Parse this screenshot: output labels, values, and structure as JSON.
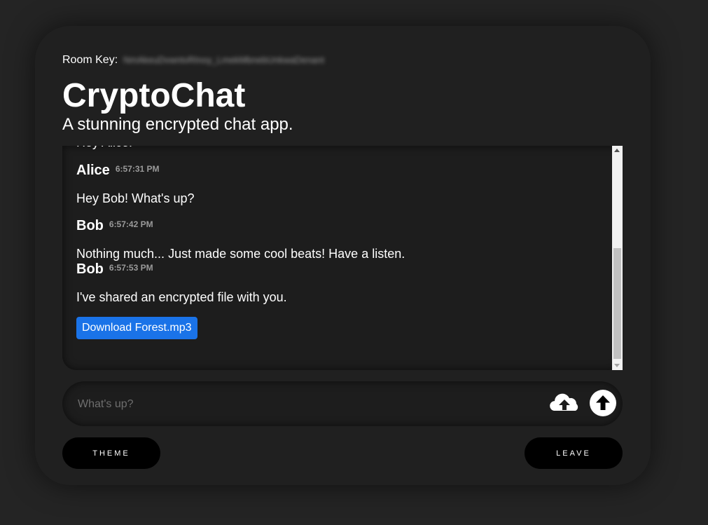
{
  "header": {
    "room_key_label": "Room Key:",
    "room_key_value": "NmAkeuDvwntvRInoy_LmekMbnebUnkwaDenant",
    "title": "CryptoChat",
    "subtitle": "A stunning encrypted chat app."
  },
  "messages": [
    {
      "author": "",
      "time": "",
      "text": "Hey Alice!"
    },
    {
      "author": "Alice",
      "time": "6:57:31 PM",
      "text": "Hey Bob! What's up?"
    },
    {
      "author": "Bob",
      "time": "6:57:42 PM",
      "text": "Nothing much... Just made some cool beats! Have a listen."
    },
    {
      "author": "Bob",
      "time": "6:57:53 PM",
      "text": "I've shared an encrypted file with you.",
      "attachment_label": "Download Forest.mp3"
    }
  ],
  "composer": {
    "placeholder": "What's up?",
    "upload_icon": "cloud-upload-icon",
    "send_icon": "arrow-up-icon"
  },
  "footer": {
    "theme_label": "THEME",
    "leave_label": "LEAVE"
  },
  "colors": {
    "background": "#242424",
    "card": "#202020",
    "accent": "#1a73e8"
  }
}
